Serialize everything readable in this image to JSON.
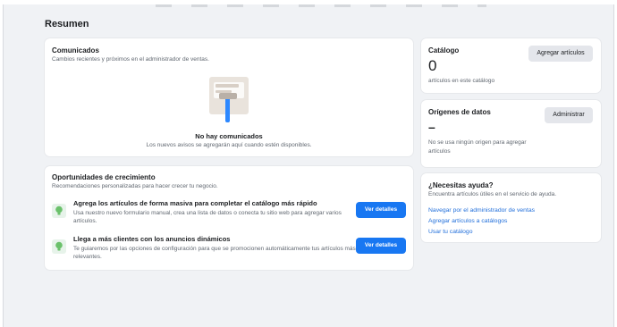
{
  "page": {
    "title": "Resumen"
  },
  "comunicados": {
    "title": "Comunicados",
    "subtitle": "Cambios recientes y próximos en el administrador de ventas.",
    "empty_title": "No hay comunicados",
    "empty_text": "Los nuevos avisos se agregarán aquí cuando estén disponibles."
  },
  "oportunidades": {
    "title": "Oportunidades de crecimiento",
    "subtitle": "Recomendaciones personalizadas para hacer crecer tu negocio.",
    "items": [
      {
        "title": "Agrega los artículos de forma masiva para completar el catálogo más rápido",
        "text": "Usa nuestro nuevo formulario manual, crea una lista de datos o conecta tu sitio web para agregar varios artículos.",
        "button": "Ver detalles"
      },
      {
        "title": "Llega a más clientes con los anuncios dinámicos",
        "text": "Te guiaremos por las opciones de configuración para que se promocionen automáticamente tus artículos más relevantes.",
        "button": "Ver detalles"
      }
    ]
  },
  "catalogo": {
    "title": "Catálogo",
    "count": "0",
    "caption": "artículos en este catálogo",
    "button": "Agregar artículos"
  },
  "origenes": {
    "title": "Orígenes de datos",
    "value": "–",
    "caption": "No se usa ningún origen para agregar artículos",
    "button": "Administrar"
  },
  "ayuda": {
    "title": "¿Necesitas ayuda?",
    "subtitle": "Encuentra artículos útiles en el servicio de ayuda.",
    "links": [
      "Navegar por el administrador de ventas",
      "Agregar artículos a catálogos",
      "Usar tu catálogo"
    ]
  },
  "colors": {
    "accent": "#1877f2",
    "link": "#216fdb",
    "background": "#f0f2f5"
  }
}
